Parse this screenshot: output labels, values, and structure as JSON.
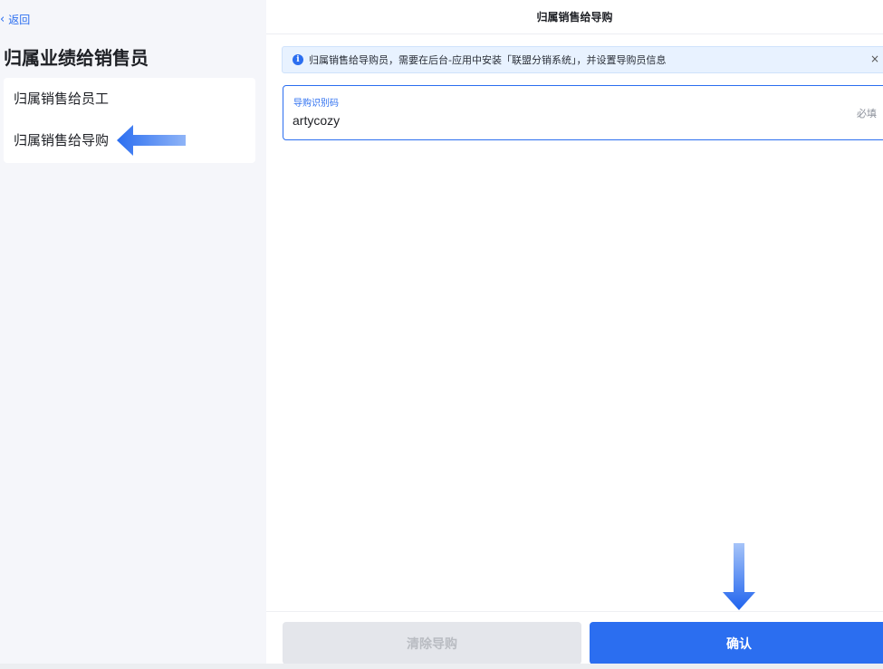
{
  "left": {
    "back_label": "返回",
    "title": "归属业绩给销售员",
    "items": [
      {
        "label": "归属销售给员工"
      },
      {
        "label": "归属销售给导购"
      }
    ]
  },
  "right": {
    "header_title": "归属销售给导购",
    "notice": {
      "text": "归属销售给导购员，需要在后台-应用中安装「联盟分销系统」，并设置导购员信息",
      "close": "×"
    },
    "field": {
      "label": "导购识别码",
      "value": "artycozy",
      "required_hint": "必填"
    },
    "buttons": {
      "clear_label": "清除导购",
      "confirm_label": "确认"
    }
  },
  "colors": {
    "accent": "#2b6ef0",
    "notice_bg": "#e8f2ff",
    "disabled_btn": "#e4e6eb"
  }
}
